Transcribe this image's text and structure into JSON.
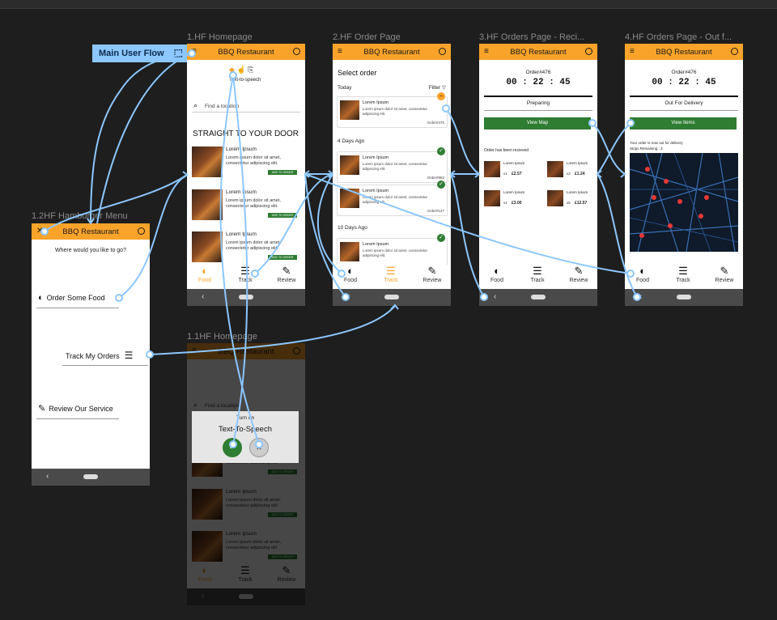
{
  "canvas": {
    "bg": "#1e1e1e"
  },
  "colors": {
    "accent": "#f9a32a",
    "wire": "#8cc7ff",
    "green": "#2e7d32"
  },
  "frames": {
    "homepage": {
      "label": "1.HF Homepage"
    },
    "homepage_tts": {
      "label": "1.1HF Homepage"
    },
    "hamburger": {
      "label": "1.2HF Hamburger Menu"
    },
    "order_page": {
      "label": "2.HF Order Page"
    },
    "receipt": {
      "label": "3.HF Orders Page - Reci..."
    },
    "out_for_delivery": {
      "label": "4.HF Orders Page - Out f..."
    }
  },
  "flow": {
    "label": "Main User Flow"
  },
  "appbar": {
    "title": "BBQ Restaurant",
    "menu_icon": "hamburger-icon",
    "profile_icon": "profile-icon"
  },
  "nav": {
    "food": "Food",
    "track": "Track",
    "review": "Review"
  },
  "homepage": {
    "tts_label": "Text-to-speech",
    "search_placeholder": "Find a location",
    "headline": "STRAIGHT TO YOUR DOOR",
    "items": [
      {
        "title": "Lorem Ipsum",
        "desc": "Lorem ipsum dolor sit amet, consectetur adipiscing elit.",
        "btn": "ADD TO ORDER"
      },
      {
        "title": "Lorem Ipsum",
        "desc": "Lorem ipsum dolor sit amet, consectetur adipiscing elit.",
        "btn": "ADD TO ORDER"
      },
      {
        "title": "Lorem Ipsum",
        "desc": "Lorem ipsum dolor sit amet, consectetur adipiscing elit.",
        "btn": "ADD TO ORDER"
      }
    ]
  },
  "tts_dialog": {
    "turn_on": "Turn on",
    "title": "Text-To-Speech",
    "confirm": "✓",
    "cancel": "✕"
  },
  "hamburger": {
    "question": "Where would you like to go?",
    "order": "Order Some Food",
    "track": "Track My Orders",
    "review": "Review Our Service"
  },
  "order_page": {
    "title": "Select order",
    "filter": "Filter",
    "sections": {
      "today": "Today",
      "four_days": "4 Days Ago",
      "ten_days": "10 Days Ago"
    },
    "orders": [
      {
        "title": "Lorem Ipsum",
        "desc": "Lorem ipsum dolor sit amet, consectetur adipiscing elit.",
        "number": "Order#476",
        "status": "pending"
      },
      {
        "title": "Lorem Ipsum",
        "desc": "Lorem ipsum dolor sit amet, consectetur adipiscing elit.",
        "number": "Order#882",
        "status": "done"
      },
      {
        "title": "Lorem Ipsum",
        "desc": "Lorem ipsum dolor sit amet, consectetur adipiscing elit.",
        "number": "Order#147",
        "status": "done"
      },
      {
        "title": "Lorem Ipsum",
        "desc": "Lorem ipsum dolor sit amet, consectetur adipiscing elit.",
        "number": "",
        "status": "done"
      }
    ]
  },
  "receipt": {
    "order_no": "Order#476",
    "timer": "00 : 22 : 45",
    "status": "Preparing",
    "btn": "View Map",
    "received": "Order has been recieved",
    "items": [
      {
        "name": "Lorem Ipsum",
        "qty": "x1",
        "price": "£2.57"
      },
      {
        "name": "Lorem Ipsum",
        "qty": "x2",
        "price": "£1.24"
      },
      {
        "name": "Lorem Ipsum",
        "qty": "x1",
        "price": "£3.00"
      },
      {
        "name": "Lorem Ipsum",
        "qty": "x5",
        "price": "£12.57"
      }
    ]
  },
  "delivery": {
    "order_no": "Order#476",
    "timer": "00 : 22 : 45",
    "status": "Out For Delivery",
    "btn": "View Items",
    "note": "Your order is now out for delivery",
    "stops": "Stops Remaining : 3"
  }
}
